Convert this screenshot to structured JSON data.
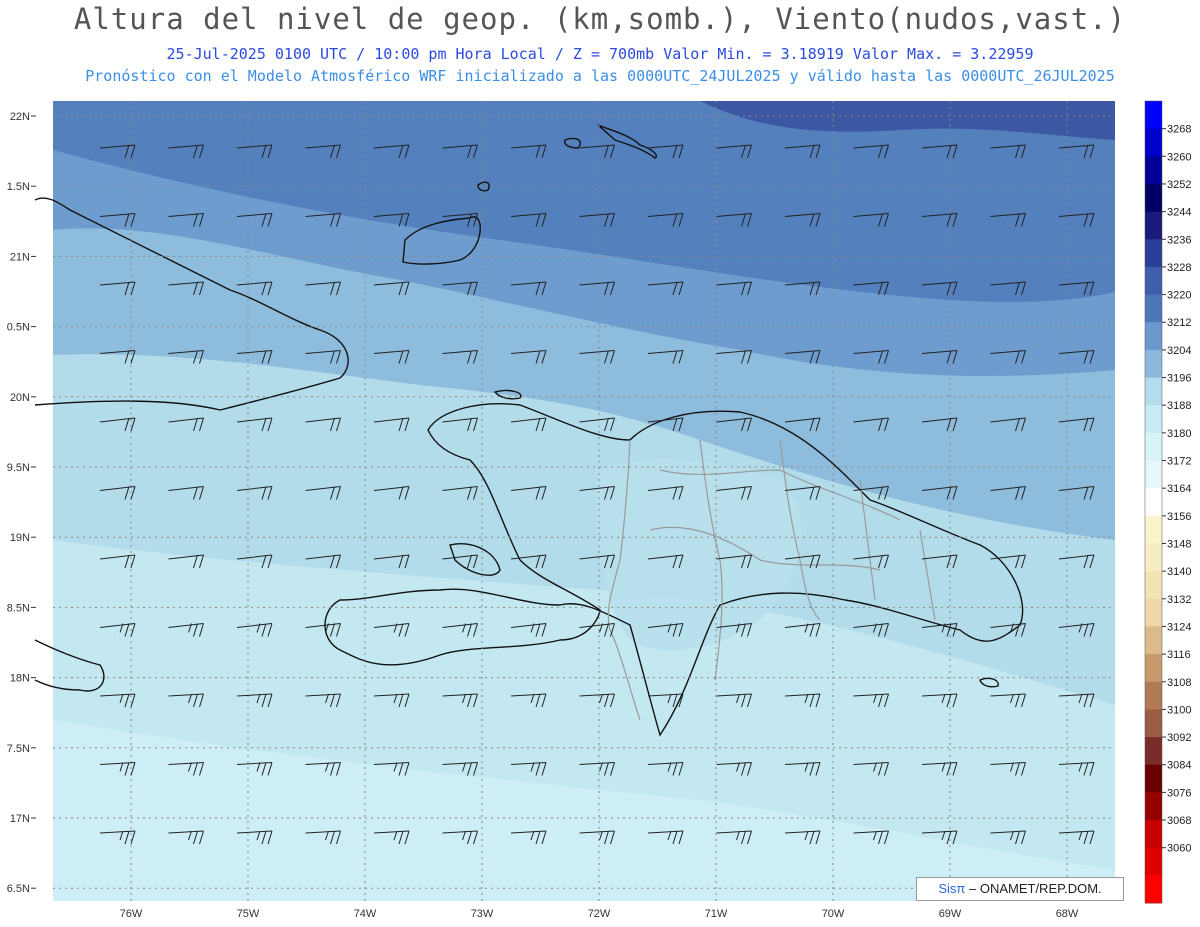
{
  "header": {
    "title": "Altura del nivel de geop. (km,somb.), Viento(nudos,vast.)",
    "subtitle": "25-Jul-2025  0100 UTC / 10:00 pm Hora Local / Z = 700mb   Valor Min. = 3.18919  Valor Max. = 3.22959",
    "caption": "Pronóstico con el Modelo Atmosférico WRF inicializado a las 0000UTC_24JUL2025 y válido hasta las  0000UTC_26JUL2025"
  },
  "axes": {
    "lat_labels": [
      "22N",
      "1.5N",
      "21N",
      "0.5N",
      "20N",
      "9.5N",
      "19N",
      "8.5N",
      "18N",
      "7.5N",
      "17N",
      "6.5N"
    ],
    "lon_labels": [
      "76W",
      "75W",
      "74W",
      "73W",
      "72W",
      "71W",
      "70W",
      "69W",
      "68W"
    ]
  },
  "colorbar": {
    "labels": [
      "3268",
      "3260",
      "3252",
      "3244",
      "3236",
      "3228",
      "3220",
      "3212",
      "3204",
      "3196",
      "3188",
      "3180",
      "3172",
      "3164",
      "3156",
      "3148",
      "3140",
      "3132",
      "3124",
      "3116",
      "3108",
      "3100",
      "3092",
      "3084",
      "3076",
      "3068",
      "3060"
    ],
    "colors": [
      "#0000ff",
      "#0000cc",
      "#000099",
      "#000066",
      "#1a1a7a",
      "#2b3f99",
      "#3f5eae",
      "#4d78b8",
      "#6b98cc",
      "#8db8dc",
      "#b5dcec",
      "#c8ecf4",
      "#d8f4f8",
      "#e6f8fb",
      "#ffffff",
      "#fbf3cc",
      "#f7edc4",
      "#f2e2b4",
      "#eed7a8",
      "#dcbb8a",
      "#c89a6c",
      "#b27a55",
      "#9a5c44",
      "#7a2c2c",
      "#6a0000",
      "#960000",
      "#c80000",
      "#e00000",
      "#ff0000"
    ]
  },
  "credit": {
    "sis": "Sisπ",
    "org": "– ONAMET/REP.DOM."
  }
}
